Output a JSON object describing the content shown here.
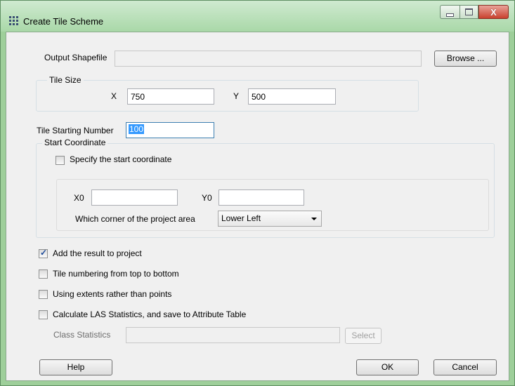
{
  "window": {
    "title": "Create Tile Scheme",
    "controls": [
      "minimize-icon",
      "maximize-icon",
      "close-icon"
    ]
  },
  "output": {
    "label": "Output Shapefile",
    "value": "",
    "browse_label": "Browse ..."
  },
  "tile_size": {
    "group_label": "Tile Size",
    "x_label": "X",
    "x_value": "750",
    "y_label": "Y",
    "y_value": "500"
  },
  "tile_start": {
    "label": "Tile Starting Number",
    "value": "100"
  },
  "start_coord": {
    "group_label": "Start Coordinate",
    "specify_label": "Specify the start coordinate",
    "specify_checked": false,
    "x0_label": "X0",
    "x0_value": "",
    "y0_label": "Y0",
    "y0_value": "",
    "corner_label": "Which corner of the project area",
    "corner_value": "Lower Left"
  },
  "options": [
    {
      "label": "Add the result to project",
      "checked": true
    },
    {
      "label": "Tile numbering from top to bottom",
      "checked": false
    },
    {
      "label": "Using extents rather than points",
      "checked": false
    },
    {
      "label": "Calculate LAS Statistics, and save to Attribute Table",
      "checked": false
    }
  ],
  "class_stats": {
    "label": "Class Statistics",
    "value": "",
    "select_label": "Select"
  },
  "buttons": {
    "help": "Help",
    "ok": "OK",
    "cancel": "Cancel"
  }
}
